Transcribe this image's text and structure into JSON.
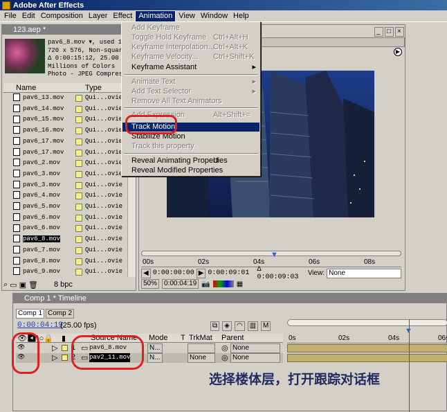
{
  "app": {
    "title": "Adobe After Effects"
  },
  "menubar": [
    "File",
    "Edit",
    "Composition",
    "Layer",
    "Effect",
    "Animation",
    "View",
    "Window",
    "Help"
  ],
  "animation_menu": [
    {
      "label": "Add Keyframe",
      "shortcut": "",
      "enabled": false,
      "submenu": false
    },
    {
      "label": "Toggle Hold Keyframe",
      "shortcut": "Ctrl+Alt+H",
      "enabled": false,
      "submenu": false
    },
    {
      "label": "Keyframe Interpolation...",
      "shortcut": "Ctrl+Alt+K",
      "enabled": false,
      "submenu": false
    },
    {
      "label": "Keyframe Velocity...",
      "shortcut": "Ctrl+Shift+K",
      "enabled": false,
      "submenu": false
    },
    {
      "label": "Keyframe Assistant",
      "shortcut": "",
      "enabled": true,
      "submenu": true
    },
    {
      "label": "Animate Text",
      "shortcut": "",
      "enabled": false,
      "submenu": true
    },
    {
      "label": "Add Text Selector",
      "shortcut": "",
      "enabled": false,
      "submenu": true
    },
    {
      "label": "Remove All Text Animators",
      "shortcut": "",
      "enabled": false,
      "submenu": false
    },
    {
      "label": "Add Expression",
      "shortcut": "Alt+Shift+=",
      "enabled": false,
      "submenu": false
    },
    {
      "label": "Track Motion",
      "shortcut": "",
      "enabled": true,
      "submenu": false,
      "selected": true
    },
    {
      "label": "Stabilize Motion",
      "shortcut": "",
      "enabled": true,
      "submenu": false
    },
    {
      "label": "Track this property",
      "shortcut": "",
      "enabled": false,
      "submenu": false
    },
    {
      "label": "Reveal Animating Properties",
      "shortcut": "U",
      "enabled": true,
      "submenu": false
    },
    {
      "label": "Reveal Modified Properties",
      "shortcut": "",
      "enabled": true,
      "submenu": false
    }
  ],
  "project": {
    "title": "123.aep *",
    "info": [
      "pav6_8.mov ▾, used 1",
      "720 x 576, Non-square",
      "Δ 0:00:15:12, 25.00 f",
      "Millions of Colors",
      "Photo - JPEG Compress"
    ],
    "col_name": "Name",
    "col_type": "Type",
    "items": [
      {
        "name": "pav6_13.mov",
        "type": "Qui...ovie"
      },
      {
        "name": "pav6_14.mov",
        "type": "Qui...ovie"
      },
      {
        "name": "pav6_15.mov",
        "type": "Qui...ovie"
      },
      {
        "name": "pav6_16.mov",
        "type": "Qui...ovie"
      },
      {
        "name": "pav6_17.mov",
        "type": "Qui...ovie"
      },
      {
        "name": "pav6_17.mov",
        "type": "Qui...ovie"
      },
      {
        "name": "pav6_2.mov",
        "type": "Qui...ovie"
      },
      {
        "name": "pav6_3.mov",
        "type": "Qui...ovie"
      },
      {
        "name": "pav6_3.mov",
        "type": "Qui...ovie"
      },
      {
        "name": "pav6_4.mov",
        "type": "Qui...ovie"
      },
      {
        "name": "pav6_5.mov",
        "type": "Qui...ovie"
      },
      {
        "name": "pav6_6.mov",
        "type": "Qui...ovie"
      },
      {
        "name": "pav6_6.mov",
        "type": "Qui...ovie"
      },
      {
        "name": "pav6_8.mov",
        "type": "Qui...ovie",
        "selected": true
      },
      {
        "name": "pav6_7.mov",
        "type": "Qui...ovie"
      },
      {
        "name": "pav6_8.mov",
        "type": "Qui...ovie"
      },
      {
        "name": "pav6_9.mov",
        "type": "Qui...ovie"
      }
    ],
    "bpc": "8 bpc"
  },
  "comp": {
    "ruler": [
      "00s",
      "02s",
      "04s",
      "06s",
      "08s"
    ],
    "time_start": "0:00:00:00",
    "time_end": "0:00:09:01",
    "duration": "Δ 0:00:09:03",
    "view_label": "View:",
    "view_value": "None",
    "zoom": "50%",
    "current_time": "0:00:04:19"
  },
  "timeline": {
    "title": "Comp 1 * Timeline",
    "tabs": [
      "Comp 1",
      "Comp 2"
    ],
    "current_time": "0:00:04:19",
    "fps": "(25.00 fps)",
    "headers": {
      "source": "Source Name",
      "mode": "Mode",
      "t": "T",
      "trkmat": "TrkMat",
      "parent": "Parent"
    },
    "ruler": [
      "0s",
      "02s",
      "04s",
      "06s"
    ],
    "layers": [
      {
        "num": "1",
        "name": "pav6_8.mov",
        "mode": "N...",
        "trkmat": "",
        "parent": "None"
      },
      {
        "num": "2",
        "name": "pav2_11.mov",
        "mode": "N...",
        "trkmat": "None",
        "parent": "None"
      }
    ]
  },
  "annotation": "选择楼体层，打开跟踪对话框"
}
